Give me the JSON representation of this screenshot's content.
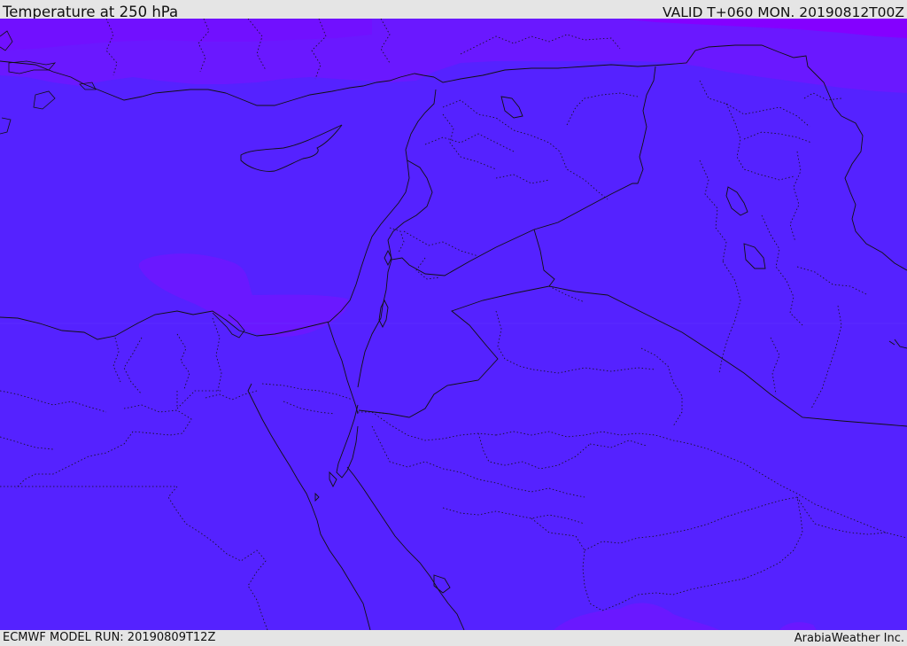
{
  "header": {
    "title": "Temperature at 250 hPa",
    "valid_time": "VALID T+060 MON. 20190812T00Z"
  },
  "footer": {
    "model_run": "ECMWF MODEL RUN: 20190809T12Z",
    "credit": "ArabiaWeather Inc."
  },
  "map": {
    "parameter": "temperature",
    "pressure_level_hpa": 250,
    "colors": {
      "base_field": "#5522ff",
      "cooler_band": "#6a18ff",
      "coldest_band": "#8400ff",
      "coastline": "#111111",
      "border": "#111111",
      "admin_border": "#111111",
      "frame_background": "#e5e5e5"
    }
  }
}
